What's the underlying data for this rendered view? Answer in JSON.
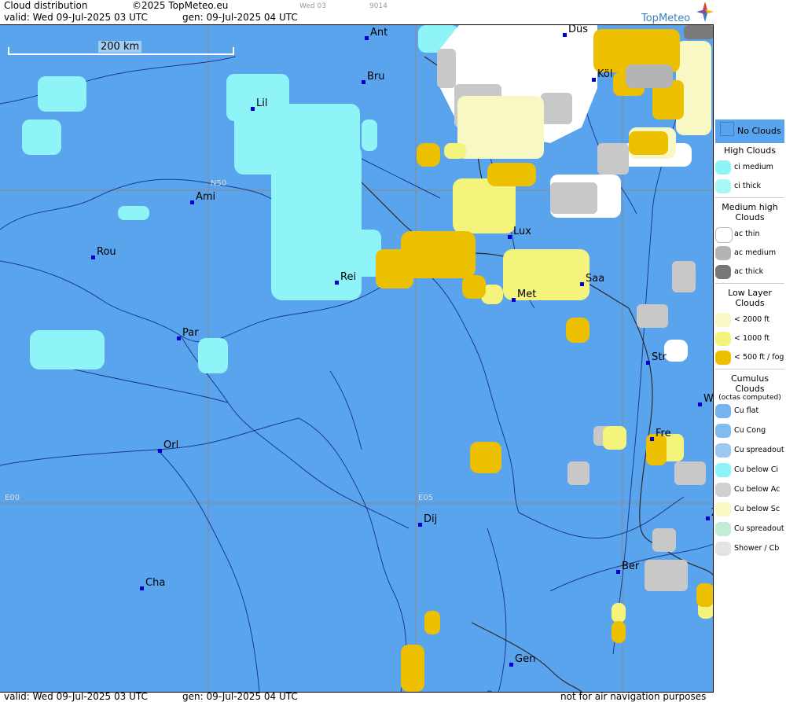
{
  "header": {
    "title": "Cloud distribution",
    "copyright": "©2025 TopMeteo.eu",
    "valid": "valid:  Wed  09-Jul-2025  03 UTC",
    "gen": "gen: 09-Jul-2025 04 UTC",
    "tiny_day": "Wed 03",
    "tiny_code": "9014",
    "logo": "TopMeteo"
  },
  "map": {
    "scale_label": "200 km",
    "grid_labels": [
      "N50",
      "E00",
      "E05"
    ],
    "cities": [
      {
        "name": "Ant"
      },
      {
        "name": "Düs"
      },
      {
        "name": "Bru"
      },
      {
        "name": "Köl"
      },
      {
        "name": "Lil"
      },
      {
        "name": "Ami"
      },
      {
        "name": "Lux"
      },
      {
        "name": "Rou"
      },
      {
        "name": "Rei"
      },
      {
        "name": "Saa"
      },
      {
        "name": "Met"
      },
      {
        "name": "Par"
      },
      {
        "name": "Str"
      },
      {
        "name": "W"
      },
      {
        "name": "Fre"
      },
      {
        "name": "Orl"
      },
      {
        "name": "Dij"
      },
      {
        "name": "Z"
      },
      {
        "name": "Ber"
      },
      {
        "name": "Cha"
      },
      {
        "name": "Gen"
      }
    ]
  },
  "legend": {
    "no_clouds": "No Clouds",
    "high_title": "High Clouds",
    "high": [
      {
        "label": "ci medium",
        "color": "#8ff4f8"
      },
      {
        "label": "ci thick",
        "color": "#a8f8f8"
      }
    ],
    "medium_title": "Medium high Clouds",
    "medium": [
      {
        "label": "ac thin",
        "color": "#ffffff"
      },
      {
        "label": "ac medium",
        "color": "#b4b4b4"
      },
      {
        "label": "ac thick",
        "color": "#787878"
      }
    ],
    "low_title": "Low Layer Clouds",
    "low": [
      {
        "label": "< 2000 ft",
        "color": "#f8f8c4"
      },
      {
        "label": "< 1000 ft",
        "color": "#f4f47c"
      },
      {
        "label": "< 500 ft / fog",
        "color": "#ecc000"
      }
    ],
    "cumulus_title": "Cumulus Clouds",
    "cumulus_sub": "(octas computed)",
    "cumulus": [
      {
        "label": "Cu flat",
        "color": "#74b4f0"
      },
      {
        "label": "Cu Cong",
        "color": "#80bcf4"
      },
      {
        "label": "Cu spreadout",
        "color": "#9cc8f0"
      },
      {
        "label": "Cu below Ci",
        "color": "#8ff4f8"
      },
      {
        "label": "Cu below Ac",
        "color": "#d0d0d0"
      },
      {
        "label": "Cu below Sc",
        "color": "#f8f8c4"
      },
      {
        "label": "Cu spreadout below Ci",
        "color": "#c0ecd8"
      },
      {
        "label": "Shower / Cb",
        "color": "#e4e4e4"
      }
    ]
  },
  "footer": {
    "valid": "valid:  Wed  09-Jul-2025  03 UTC",
    "gen": "gen: 09-Jul-2025 04 UTC",
    "disclaimer": "not for air navigation purposes"
  }
}
